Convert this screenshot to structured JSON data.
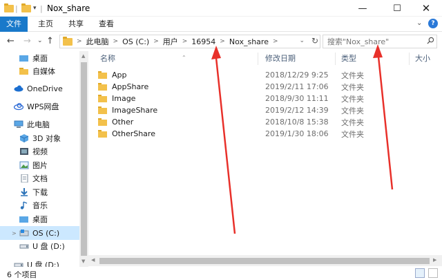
{
  "window": {
    "title": "Nox_share"
  },
  "ribbon": {
    "tabs": [
      "文件",
      "主页",
      "共享",
      "查看"
    ]
  },
  "address": {
    "crumbs": [
      "此电脑",
      "OS (C:)",
      "用户",
      "16954",
      "Nox_share"
    ],
    "search_placeholder": "搜索\"Nox_share\""
  },
  "sidebar": {
    "items": [
      {
        "label": "桌面",
        "icon": "folder-icon"
      },
      {
        "label": "自媒体",
        "icon": "folder-icon"
      },
      {
        "label": "OneDrive",
        "icon": "cloud-icon"
      },
      {
        "label": "WPS网盘",
        "icon": "cloud-icon"
      },
      {
        "label": "此电脑",
        "icon": "computer-icon"
      },
      {
        "label": "3D 对象",
        "icon": "cube-icon"
      },
      {
        "label": "视频",
        "icon": "video-icon"
      },
      {
        "label": "图片",
        "icon": "picture-icon"
      },
      {
        "label": "文档",
        "icon": "document-icon"
      },
      {
        "label": "下载",
        "icon": "download-icon"
      },
      {
        "label": "音乐",
        "icon": "music-icon"
      },
      {
        "label": "桌面",
        "icon": "desktop-icon"
      },
      {
        "label": "OS (C:)",
        "icon": "drive-icon"
      },
      {
        "label": "U 盘 (D:)",
        "icon": "usb-icon"
      },
      {
        "label": "U 盘 (D:)",
        "icon": "usb-icon"
      }
    ]
  },
  "columns": {
    "name": "名称",
    "date": "修改日期",
    "type": "类型",
    "size": "大小"
  },
  "files": [
    {
      "name": "App",
      "date": "2018/12/29 9:25",
      "type": "文件夹"
    },
    {
      "name": "AppShare",
      "date": "2019/2/11 17:06",
      "type": "文件夹"
    },
    {
      "name": "Image",
      "date": "2018/9/30 11:11",
      "type": "文件夹"
    },
    {
      "name": "ImageShare",
      "date": "2019/2/12 14:39",
      "type": "文件夹"
    },
    {
      "name": "Other",
      "date": "2018/10/8 15:38",
      "type": "文件夹"
    },
    {
      "name": "OtherShare",
      "date": "2019/1/30 18:06",
      "type": "文件夹"
    }
  ],
  "status": {
    "count": "6 个项目"
  },
  "colors": {
    "accent": "#1979ca",
    "selection": "#cce8ff",
    "folder": "#f3c14b",
    "annotation": "#e8302a"
  }
}
